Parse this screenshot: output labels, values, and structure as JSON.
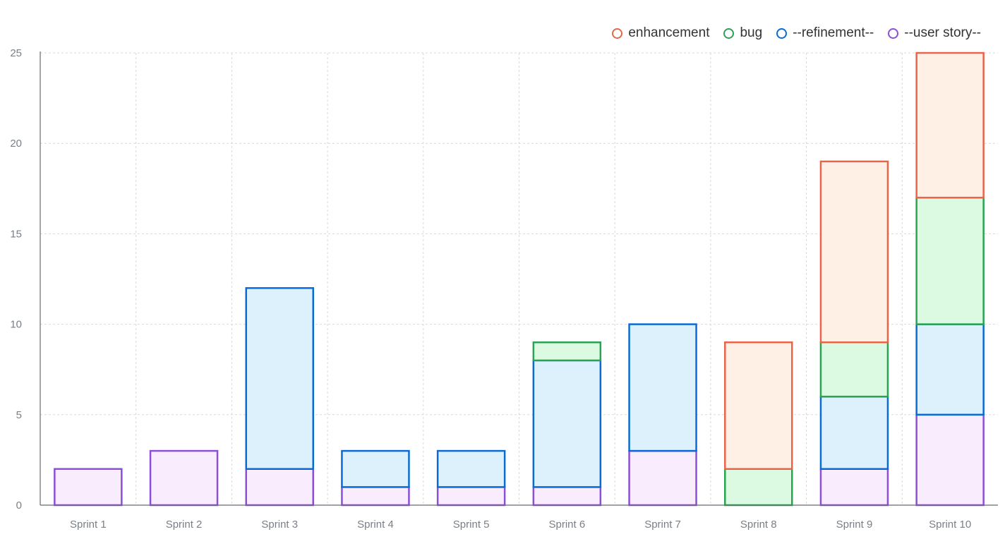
{
  "chart_data": {
    "type": "bar",
    "stacked": true,
    "categories": [
      "Sprint 1",
      "Sprint 2",
      "Sprint 3",
      "Sprint 4",
      "Sprint 5",
      "Sprint 6",
      "Sprint 7",
      "Sprint 8",
      "Sprint 9",
      "Sprint 10"
    ],
    "series": [
      {
        "name": "--user story--",
        "border": "#8c4fd6",
        "fill": "#f9ecfd",
        "values": [
          2,
          3,
          2,
          1,
          1,
          1,
          3,
          0,
          2,
          5
        ]
      },
      {
        "name": "--refinement--",
        "border": "#0b6bd6",
        "fill": "#dcf1fb",
        "values": [
          0,
          0,
          10,
          2,
          2,
          7,
          7,
          0,
          4,
          5
        ]
      },
      {
        "name": "bug",
        "border": "#2aa352",
        "fill": "#dcf9e1",
        "values": [
          0,
          0,
          0,
          0,
          0,
          1,
          0,
          2,
          3,
          7
        ]
      },
      {
        "name": "enhancement",
        "border": "#e8654a",
        "fill": "#fff0e6",
        "values": [
          0,
          0,
          0,
          0,
          0,
          0,
          0,
          7,
          10,
          8
        ]
      }
    ],
    "legend_order": [
      "enhancement",
      "bug",
      "--refinement--",
      "--user story--"
    ],
    "ylim": [
      0,
      25
    ],
    "yticks": [
      0,
      5,
      10,
      15,
      20,
      25
    ],
    "grid": true,
    "legend_position": "top-right",
    "title": "",
    "xlabel": "",
    "ylabel": ""
  }
}
